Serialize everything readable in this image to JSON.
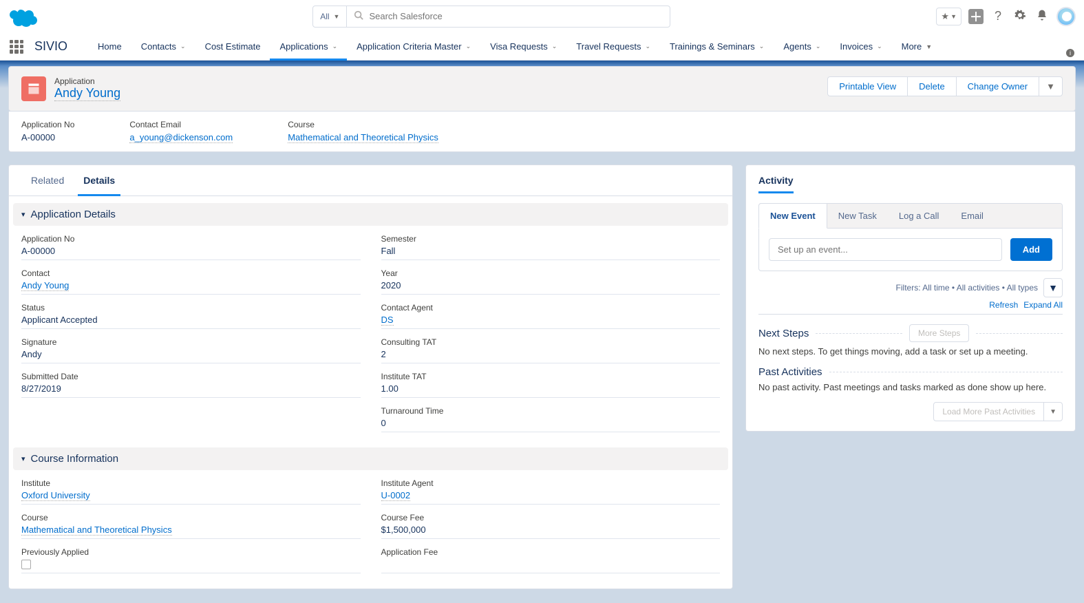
{
  "header": {
    "search_scope": "All",
    "search_placeholder": "Search Salesforce"
  },
  "nav": {
    "app_name": "SIVIO",
    "tabs": [
      "Home",
      "Contacts",
      "Cost Estimate",
      "Applications",
      "Application Criteria Master",
      "Visa Requests",
      "Travel Requests",
      "Trainings & Seminars",
      "Agents",
      "Invoices",
      "More"
    ],
    "active_tab": "Applications"
  },
  "record": {
    "object_label": "Application",
    "name": "Andy Young",
    "actions": {
      "printable": "Printable View",
      "delete": "Delete",
      "change_owner": "Change Owner"
    }
  },
  "highlights": {
    "app_no": {
      "label": "Application No",
      "value": "A-00000"
    },
    "contact_email": {
      "label": "Contact Email",
      "value": "a_young@dickenson.com"
    },
    "course": {
      "label": "Course",
      "value": "Mathematical and Theoretical Physics"
    }
  },
  "main_tabs": {
    "related": "Related",
    "details": "Details"
  },
  "sections": {
    "app_details": {
      "title": "Application Details",
      "left": {
        "app_no": {
          "label": "Application No",
          "value": "A-00000",
          "editable": false,
          "link": false
        },
        "contact": {
          "label": "Contact",
          "value": "Andy Young",
          "editable": true,
          "link": true
        },
        "status": {
          "label": "Status",
          "value": "Applicant Accepted",
          "editable": true,
          "link": false
        },
        "signature": {
          "label": "Signature",
          "value": "Andy",
          "editable": true,
          "link": false
        },
        "submitted": {
          "label": "Submitted Date",
          "value": "8/27/2019",
          "editable": true,
          "link": false
        }
      },
      "right": {
        "semester": {
          "label": "Semester",
          "value": "Fall",
          "editable": true,
          "link": false
        },
        "year": {
          "label": "Year",
          "value": "2020",
          "editable": true,
          "link": false
        },
        "contact_agent": {
          "label": "Contact Agent",
          "value": "DS",
          "editable": true,
          "link": true
        },
        "consulting_tat": {
          "label": "Consulting TAT",
          "value": "2",
          "editable": false,
          "link": false
        },
        "institute_tat": {
          "label": "Institute TAT",
          "value": "1.00",
          "editable": false,
          "link": false
        },
        "turnaround": {
          "label": "Turnaround Time",
          "value": "0",
          "editable": false,
          "link": false
        }
      }
    },
    "course_info": {
      "title": "Course Information",
      "left": {
        "institute": {
          "label": "Institute",
          "value": "Oxford University",
          "editable": true,
          "link": true
        },
        "course": {
          "label": "Course",
          "value": "Mathematical and Theoretical Physics",
          "editable": true,
          "link": true
        },
        "prev_applied": {
          "label": "Previously Applied",
          "value": "",
          "editable": true,
          "link": false,
          "is_checkbox": true
        }
      },
      "right": {
        "inst_agent": {
          "label": "Institute Agent",
          "value": "U-0002",
          "editable": true,
          "link": true
        },
        "course_fee": {
          "label": "Course Fee",
          "value": "$1,500,000",
          "editable": false,
          "link": false
        },
        "app_fee": {
          "label": "Application Fee",
          "value": "",
          "editable": false,
          "link": false
        }
      }
    }
  },
  "activity": {
    "tab_label": "Activity",
    "tabs": [
      "New Event",
      "New Task",
      "Log a Call",
      "Email"
    ],
    "active_act_tab": "New Event",
    "event_placeholder": "Set up an event...",
    "add_label": "Add",
    "filters_text": "Filters: All time • All activities • All types",
    "refresh": "Refresh",
    "expand_all": "Expand All",
    "next_steps_hdr": "Next Steps",
    "more_steps": "More Steps",
    "no_next": "No next steps. To get things moving, add a task or set up a meeting.",
    "past_hdr": "Past Activities",
    "no_past": "No past activity. Past meetings and tasks marked as done show up here.",
    "load_more": "Load More Past Activities"
  }
}
